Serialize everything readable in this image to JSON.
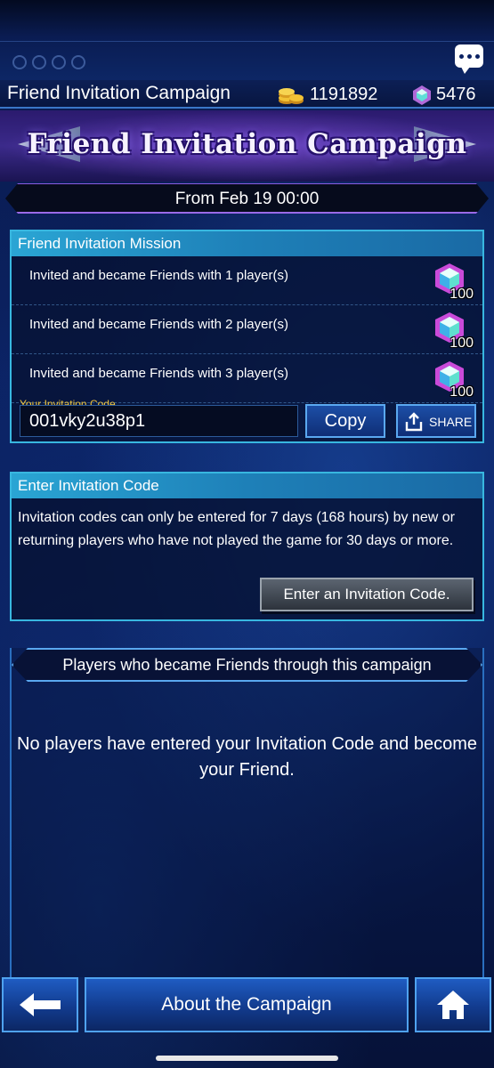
{
  "header": {
    "title": "Friend Invitation Campaign",
    "coins": "1191892",
    "gems": "5476"
  },
  "banner": {
    "title": "Friend Invitation Campaign"
  },
  "period": "From Feb 19 00:00",
  "mission": {
    "title": "Friend Invitation Mission",
    "rows": [
      {
        "text": "Invited and became Friends with 1 player(s)",
        "reward": "100"
      },
      {
        "text": "Invited and became Friends with 2 player(s)",
        "reward": "100"
      },
      {
        "text": "Invited and became Friends with 3 player(s)",
        "reward": "100"
      }
    ],
    "code_label": "Your Invitation Code",
    "code_value": "001vky2u38p1",
    "copy_label": "Copy",
    "share_label": "SHARE"
  },
  "enter": {
    "title": "Enter Invitation Code",
    "description": "Invitation codes can only be entered for 7 days (168 hours) by new or returning players who have not played the game for 30 days or more.",
    "button_label": "Enter an Invitation Code."
  },
  "friends": {
    "title": "Players who became Friends through this campaign",
    "empty_message": "No players have entered your Invitation Code and become your Friend."
  },
  "footer": {
    "about_label": "About the Campaign"
  },
  "icons": {
    "chat": "chat-bubble-icon",
    "coins": "gold-coins-icon",
    "gem": "crystal-gem-icon",
    "share": "share-icon",
    "back": "back-arrow-icon",
    "home": "home-icon"
  },
  "colors": {
    "panel_header": "#2aa5d4",
    "panel_border": "#38b7e0",
    "code_label": "#f4c73b",
    "background": "#0b2263"
  }
}
